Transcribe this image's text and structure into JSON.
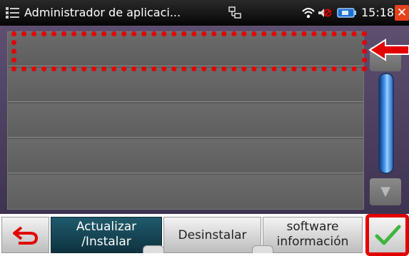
{
  "statusbar": {
    "title": "Administrador de aplicaci...",
    "time": "15:18",
    "close_glyph": "✕"
  },
  "list": {
    "rows": [
      "",
      "",
      "",
      "",
      ""
    ]
  },
  "scrollbar": {
    "down_glyph": "▼"
  },
  "toolbar": {
    "update_line1": "Actualizar",
    "update_line2": "/Instalar",
    "uninstall_label": "Desinstalar",
    "info_line1": "software",
    "info_line2": "información"
  },
  "icons": [
    "app-manager-icon",
    "network-icon",
    "wifi-icon",
    "volume-muted-icon",
    "battery-icon",
    "close-icon",
    "back-arrow-icon",
    "checkmark-icon",
    "red-pointer-arrow-icon"
  ],
  "colors": {
    "accent_red": "#e30000",
    "active_button": "#1f5a6b",
    "scroll_thumb": "#55a8ff",
    "close_red": "#e4411d"
  }
}
